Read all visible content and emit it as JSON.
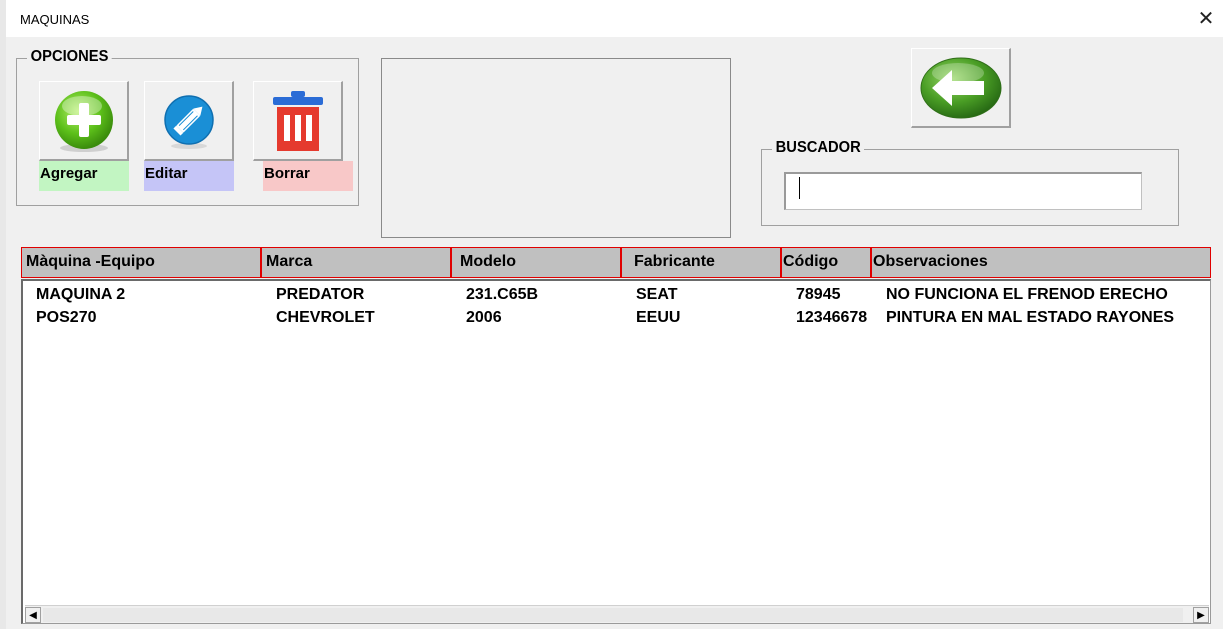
{
  "window": {
    "title": "MAQUINAS",
    "close_glyph": "✕"
  },
  "options": {
    "label": "OPCIONES",
    "buttons": [
      {
        "label": "Agregar",
        "icon": "plus-icon",
        "label_bg": "#c2f5c2"
      },
      {
        "label": "Editar",
        "icon": "pencil-icon",
        "label_bg": "#c5c5f7"
      },
      {
        "label": "Borrar",
        "icon": "trash-icon",
        "label_bg": "#f8c8c8"
      }
    ]
  },
  "back": {
    "icon": "arrow-left-icon"
  },
  "search": {
    "label": "BUSCADOR",
    "value": ""
  },
  "table": {
    "columns": [
      "Màquina -Equipo",
      "Marca",
      "Modelo",
      "Fabricante",
      "Código",
      "Observaciones"
    ],
    "rows": [
      [
        "MAQUINA 2",
        "PREDATOR",
        "231.C65B",
        "SEAT",
        "78945",
        "NO FUNCIONA EL FRENOD ERECHO"
      ],
      [
        "POS270",
        "CHEVROLET",
        "2006",
        "EEUU",
        "12346678",
        "PINTURA EN MAL ESTADO RAYONES"
      ]
    ]
  },
  "scrollbar": {
    "left_glyph": "◀",
    "right_glyph": "▶"
  },
  "colors": {
    "header_border": "#e00000",
    "header_bg": "#c0c0c0"
  }
}
